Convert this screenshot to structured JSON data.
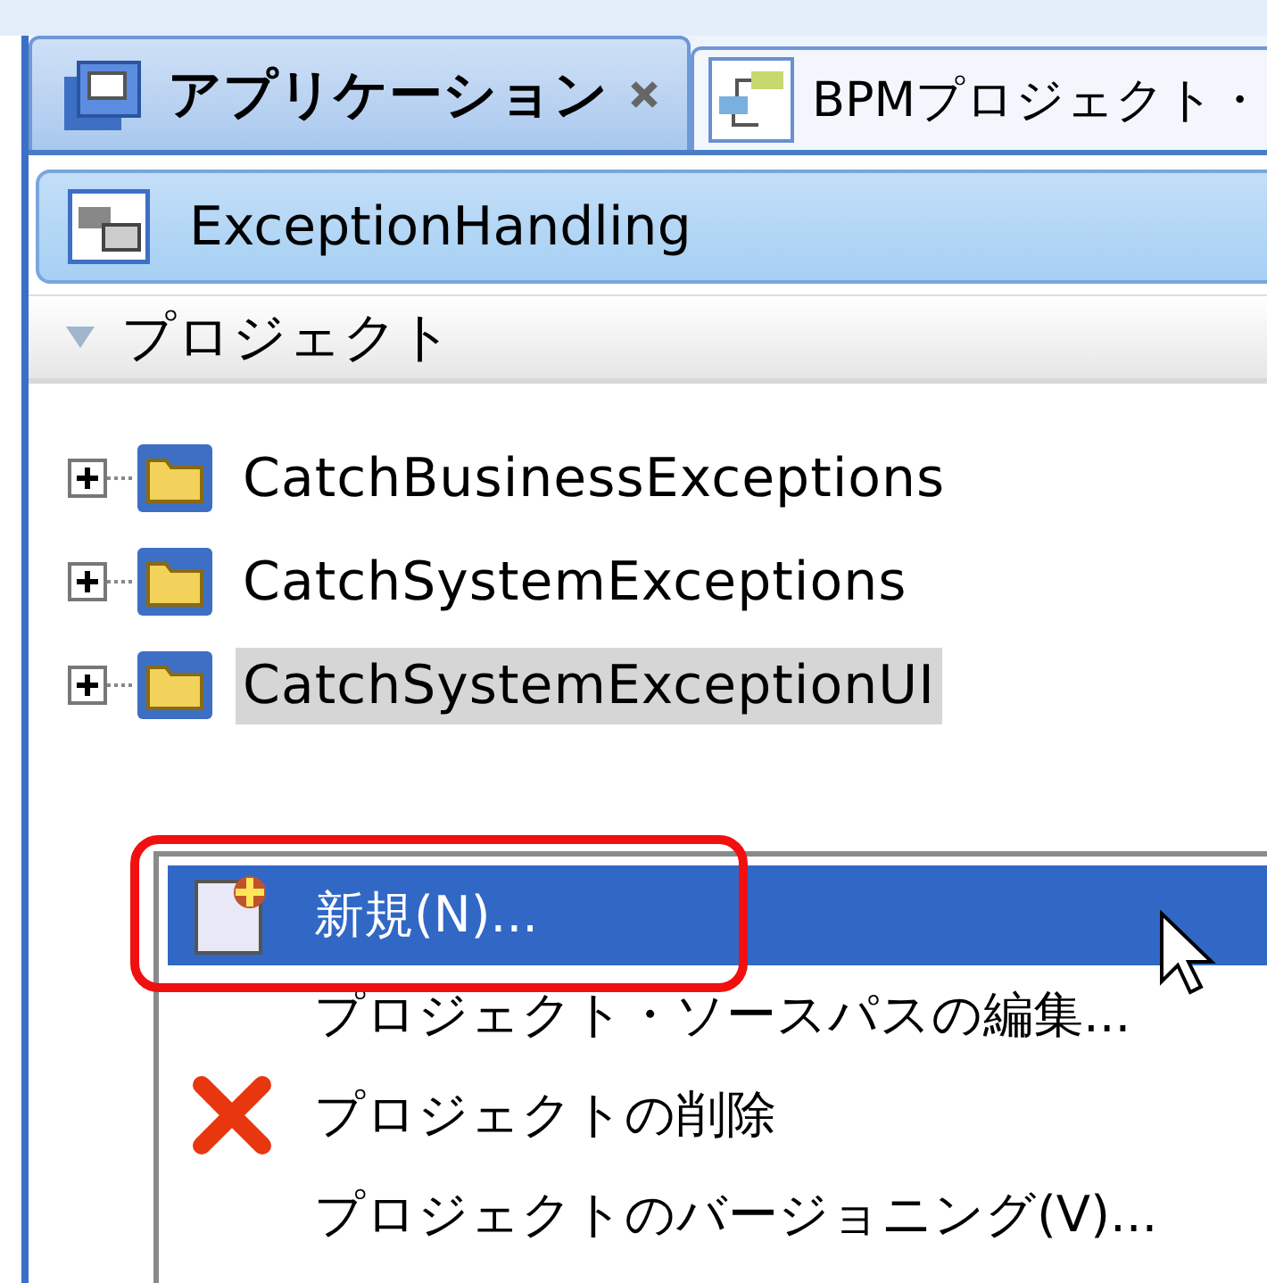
{
  "tabs": [
    {
      "label": "アプリケーション",
      "selected": true
    },
    {
      "label": "BPMプロジェクト・",
      "selected": false
    }
  ],
  "application": {
    "name": "ExceptionHandling"
  },
  "section": {
    "title": "プロジェクト",
    "expanded": true
  },
  "projects": [
    {
      "name": "CatchBusinessExceptions",
      "selected": false,
      "expanded": false
    },
    {
      "name": "CatchSystemExceptions",
      "selected": false,
      "expanded": false
    },
    {
      "name": "CatchSystemExceptionUI",
      "selected": true,
      "expanded": false
    }
  ],
  "context_menu": {
    "items": [
      {
        "label": "新規(N)...",
        "selected": true,
        "highlighted": true,
        "kind": "new"
      },
      {
        "label": "プロジェクト・ソースパスの編集...",
        "selected": false,
        "highlighted": false,
        "kind": "plain"
      },
      {
        "label": "プロジェクトの削除",
        "selected": false,
        "highlighted": false,
        "kind": "delete"
      },
      {
        "label": "プロジェクトのバージョニング(V)...",
        "selected": false,
        "highlighted": false,
        "kind": "plain"
      }
    ]
  }
}
